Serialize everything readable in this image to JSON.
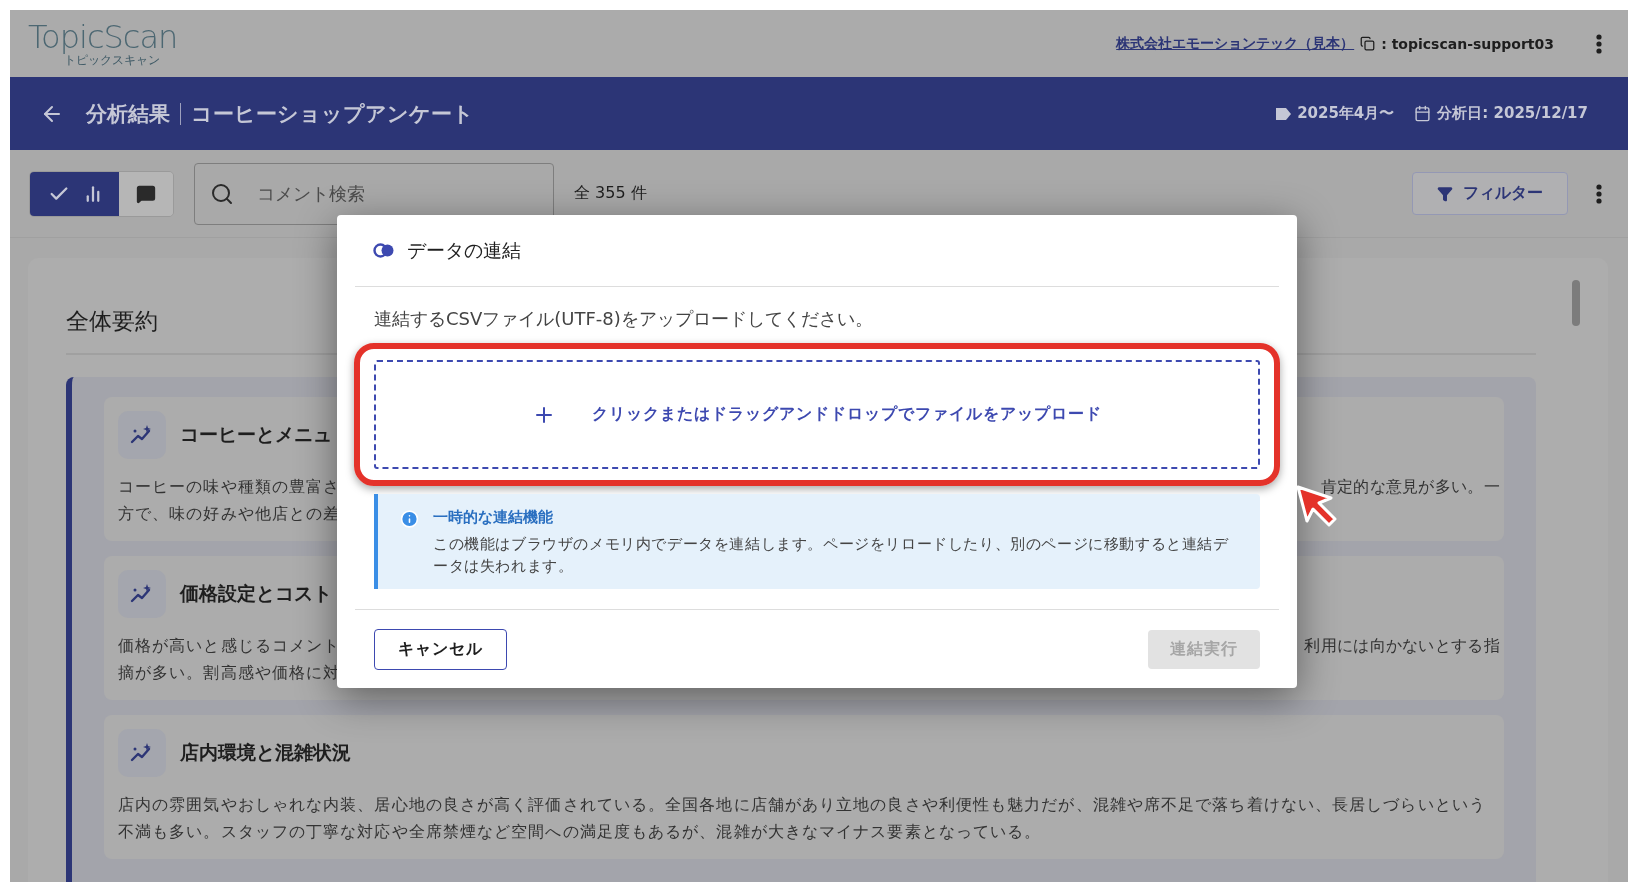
{
  "header": {
    "logo": "TopicScan",
    "logo_sub": "トピックスキャン",
    "company_link": "株式会社エモーションテック（見本）",
    "user": ": topicscan-support03"
  },
  "title_bar": {
    "section": "分析結果",
    "survey": "コーヒーショップアンケート",
    "period": "2025年4月〜",
    "analysis_date": "分析日: 2025/12/17"
  },
  "toolbar": {
    "views": [
      {
        "kind": "chart",
        "selected": true
      },
      {
        "kind": "comments",
        "selected": false
      }
    ],
    "search": {
      "placeholder": "コメント検索"
    },
    "count": "全 355 件",
    "filter_button": "フィルター"
  },
  "summary": {
    "heading": "全体要約",
    "topics": [
      {
        "kind": "covered",
        "title": "コーヒーとメニュ",
        "text_left": [
          "コーヒーの味や種類の豊富さ",
          "方で、味の好みや他店との差"
        ],
        "text_right": [
          "肯定的な意見が多い。一"
        ]
      },
      {
        "kind": "covered",
        "title": "価格設定とコスト",
        "text_left": [
          "価格が高いと感じるコメント",
          "摘が多い。割高感や価格に対"
        ],
        "text_right": [
          "利用には向かないとする指"
        ]
      },
      {
        "kind": "full",
        "title": "店内環境と混雑状況",
        "text": "店内の雰囲気やおしゃれな内装、居心地の良さが高く評価されている。全国各地に店舗があり立地の良さや利便性も魅力だが、混雑や席不足で落ち着けない、長居しづらいという不満も多い。スタッフの丁寧な対応や全席禁煙など空間への満足度もあるが、混雑が大きなマイナス要素となっている。"
      }
    ]
  },
  "dialog": {
    "title": "データの連結",
    "description": "連結するCSVファイル(UTF-8)をアップロードしてください。",
    "dropzone": "クリックまたはドラッグアンドドロップでファイルをアップロード",
    "info": {
      "title": "一時的な連結機能",
      "text": "この機能はブラウザのメモリ内でデータを連結します。ページをリロードしたり、別のページに移動すると連結データは失われます。"
    },
    "cancel_button": "キャンセル",
    "execute_button": {
      "label": "連結実行",
      "disabled": true
    }
  }
}
